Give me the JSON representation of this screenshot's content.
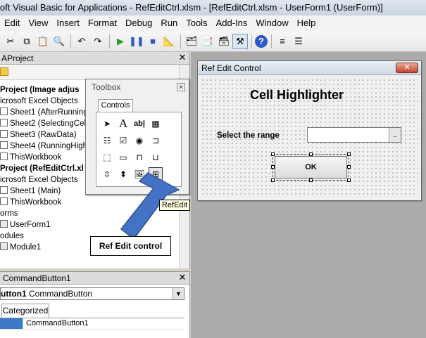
{
  "window": {
    "title": "oft Visual Basic for Applications - RefEditCtrl.xlsm - [RefEditCtrl.xlsm - UserForm1 (UserForm)]"
  },
  "menu": [
    "Edit",
    "View",
    "Insert",
    "Format",
    "Debug",
    "Run",
    "Tools",
    "Add-Ins",
    "Window",
    "Help"
  ],
  "project_pane": {
    "title": "AProject",
    "tree": [
      {
        "label": "Project (Image adjus",
        "bold": true,
        "icon": "project-icon"
      },
      {
        "label": "icrosoft Excel Objects",
        "bold": false,
        "icon": "folder-icon"
      },
      {
        "label": "Sheet1 (AfterRunning",
        "bold": false,
        "icon": "sheet-icon"
      },
      {
        "label": "Sheet2 (SelectingCells",
        "bold": false,
        "icon": "sheet-icon"
      },
      {
        "label": "Sheet3 (RawData)",
        "bold": false,
        "icon": "sheet-icon"
      },
      {
        "label": "Sheet4 (RunningHighli",
        "bold": false,
        "icon": "sheet-icon"
      },
      {
        "label": "ThisWorkbook",
        "bold": false,
        "icon": "workbook-icon"
      },
      {
        "label": "Project (RefEditCtrl.xl",
        "bold": true,
        "icon": "project-icon"
      },
      {
        "label": "icrosoft Excel Objects",
        "bold": false,
        "icon": "folder-icon"
      },
      {
        "label": "Sheet1 (Main)",
        "bold": false,
        "icon": "sheet-icon"
      },
      {
        "label": "ThisWorkbook",
        "bold": false,
        "icon": "workbook-icon"
      },
      {
        "label": "orms",
        "bold": false,
        "icon": "folder-icon"
      },
      {
        "label": "UserForm1",
        "bold": false,
        "icon": "userform-icon"
      },
      {
        "label": "odules",
        "bold": false,
        "icon": "folder-icon"
      },
      {
        "label": "Module1",
        "bold": false,
        "icon": "module-icon"
      }
    ]
  },
  "properties_pane": {
    "title": "CommandButton1",
    "combo_name": "utton1",
    "combo_type": "CommandButton",
    "tab": "Categorized",
    "row_value": "CommandButton1"
  },
  "toolbox": {
    "title": "Toolbox",
    "tab": "Controls",
    "tooltip": "RefEdit"
  },
  "userform": {
    "title": "Ref Edit Control",
    "heading": "Cell Highlighter",
    "range_label": "Select the range",
    "refedit_btn": "_",
    "ok_label": "OK"
  },
  "callout": {
    "label": "Ref Edit control"
  },
  "colors": {
    "callout_arrow": "#4472c4",
    "callout_arrow_border": "#2f528f"
  }
}
